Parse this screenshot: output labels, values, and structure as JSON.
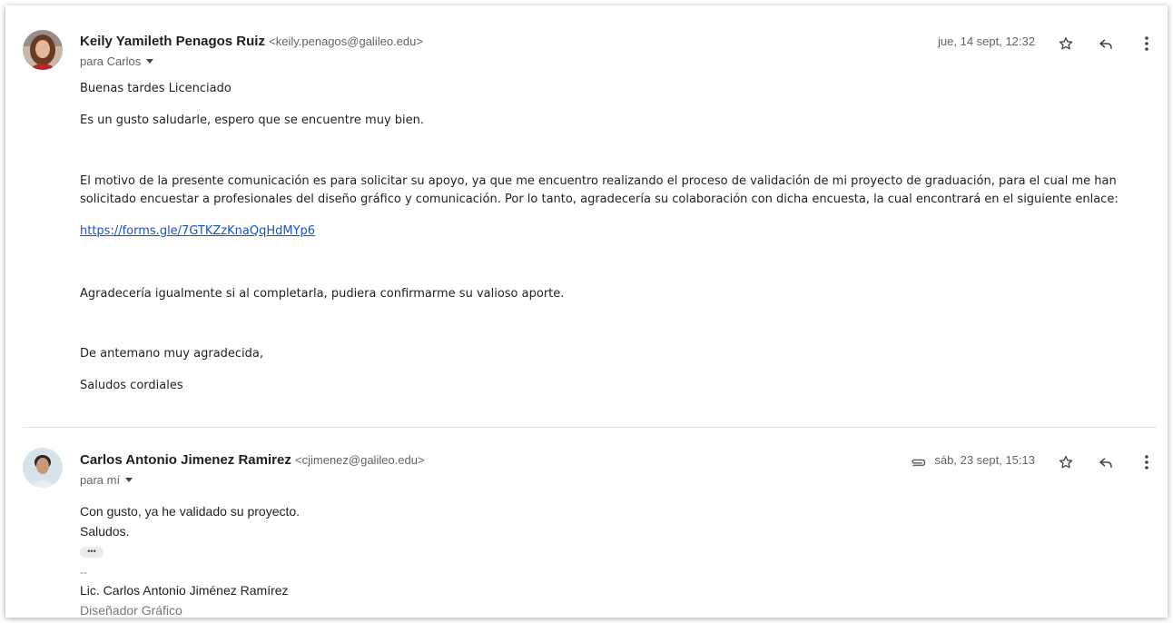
{
  "messages": [
    {
      "sender_name": "Keily Yamileth Penagos Ruiz",
      "sender_email": "<keily.penagos@galileo.edu>",
      "recipient": "para Carlos",
      "date": "jue, 14 sept, 12:32",
      "body": [
        "Buenas tardes Licenciado",
        "Es un gusto saludarle, espero que se encuentre muy bien.",
        "El motivo de la presente comunicación es para solicitar su apoyo, ya que me encuentro realizando el proceso de validación de mi proyecto de graduación, para el cual me han solicitado encuestar a profesionales del diseño gráfico y comunicación. Por lo tanto, agradecería su colaboración con dicha encuesta, la cual encontrará en el siguiente enlace:",
        "https://forms.gle/7GTKZzKnaQqHdMYp6",
        "Agradecería igualmente si al completarla, pudiera confirmarme su valioso aporte.",
        "De antemano muy agradecida,",
        "Saludos cordiales"
      ]
    },
    {
      "sender_name": "Carlos Antonio Jimenez Ramirez",
      "sender_email": "<cjimenez@galileo.edu>",
      "recipient": "para mí",
      "date": "sáb, 23 sept, 15:13",
      "body": [
        "Con gusto, ya he validado su proyecto.",
        "Saludos.",
        "•••",
        "--",
        "Lic. Carlos Antonio Jiménez Ramírez",
        "Diseñador Gráfico"
      ]
    }
  ],
  "icons": [
    "star-icon",
    "reply-icon",
    "more-vert-icon",
    "attachment-icon"
  ],
  "colors": {
    "link": "#1155cc",
    "secondary_text": "#5f6368"
  }
}
